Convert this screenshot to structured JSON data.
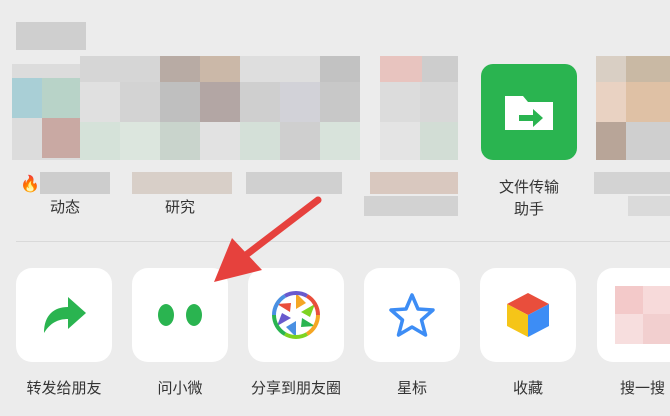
{
  "top_row": {
    "contacts": [
      {
        "label": "动态"
      },
      {
        "label": "研究"
      },
      {
        "label_line1": "文件传输",
        "label_line2": "助手"
      }
    ]
  },
  "actions": [
    {
      "label": "转发给朋友",
      "icon": "forward-arrow-icon"
    },
    {
      "label": "问小微",
      "icon": "ask-xiaowei-icon"
    },
    {
      "label": "分享到朋友圈",
      "icon": "moments-aperture-icon"
    },
    {
      "label": "星标",
      "icon": "star-icon"
    },
    {
      "label": "收藏",
      "icon": "favorites-cube-icon"
    },
    {
      "label": "搜一搜",
      "icon": "search-icon"
    }
  ],
  "colors": {
    "green": "#2ab450",
    "star_blue": "#3d8df5",
    "arrow_red": "#e6413d"
  }
}
